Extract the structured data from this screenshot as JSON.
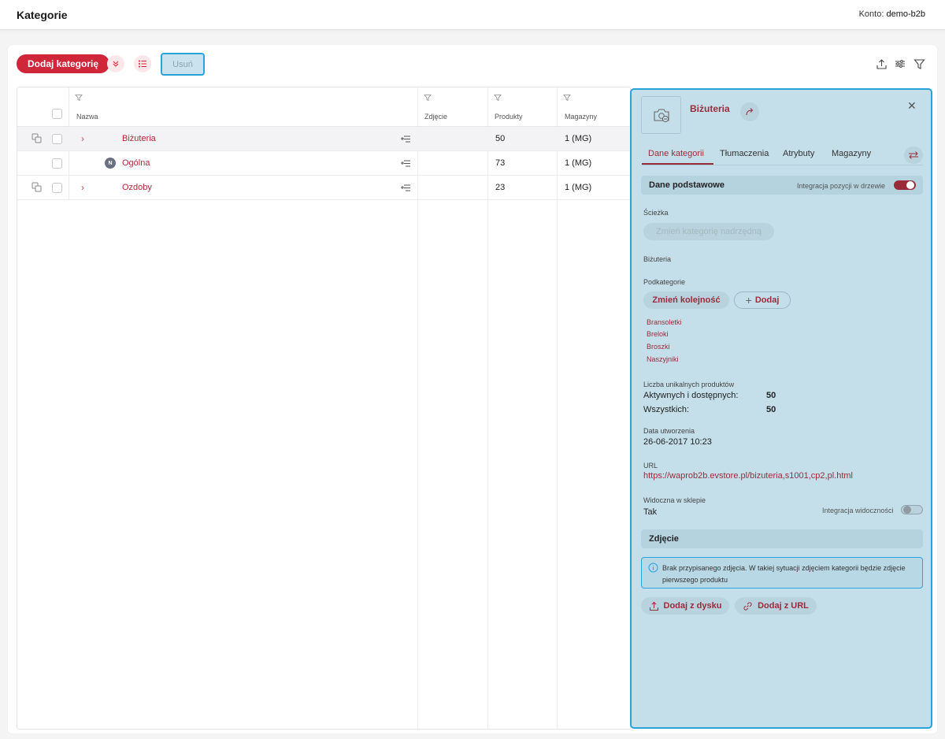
{
  "header": {
    "title": "Kategorie",
    "account_label": "Konto:",
    "account_value": "demo-b2b"
  },
  "toolbar": {
    "add_label": "Dodaj kategorię",
    "delete_label": "Usuń",
    "icons": [
      "chevrons-down-icon",
      "list-icon",
      "upload-icon",
      "sliders-icon",
      "filter-icon"
    ]
  },
  "grid": {
    "columns": [
      "Nazwa",
      "Zdjęcie",
      "Produkty",
      "Magazyny"
    ],
    "rows": [
      {
        "name": "Biżuteria",
        "products": "50",
        "warehouses": "1 (MG)",
        "expandable": true,
        "selected": true
      },
      {
        "name": "Ogólna",
        "products": "73",
        "warehouses": "1 (MG)",
        "expandable": false,
        "badge": "N"
      },
      {
        "name": "Ozdoby",
        "products": "23",
        "warehouses": "1 (MG)",
        "expandable": true
      }
    ]
  },
  "panel": {
    "title": "Biżuteria",
    "tabs": [
      "Dane kategorii",
      "Tłumaczenia",
      "Atrybuty",
      "Magazyny"
    ],
    "active_tab": "Dane kategorii",
    "basic_section": "Dane podstawowe",
    "tree_integration_label": "Integracja pozycji w drzewie",
    "path_label": "Ścieżka",
    "change_parent_label": "Zmień kategorię nadrzędną",
    "path_value": "Biżuteria",
    "subcategories_label": "Podkategorie",
    "reorder_label": "Zmień kolejność",
    "add_label": "Dodaj",
    "subcategories": [
      "Bransoletki",
      "Breloki",
      "Broszki",
      "Naszyjniki"
    ],
    "unique_products_label": "Liczba unikalnych produktów",
    "active_label": "Aktywnych i dostępnych:",
    "active_value": "50",
    "all_label": "Wszystkich:",
    "all_value": "50",
    "created_label": "Data utworzenia",
    "created_value": "26-06-2017 10:23",
    "url_label": "URL",
    "url_value": "https://waprob2b.evstore.pl/bizuteria,s1001,cp2,pl.html",
    "visible_label": "Widoczna w sklepie",
    "visible_value": "Tak",
    "visibility_integration_label": "Integracja widoczności",
    "photo_section": "Zdjęcie",
    "photo_info": "Brak przypisanego zdjęcia. W takiej sytuacji zdjęciem kategorii będzie zdjęcie pierwszego produktu",
    "add_from_disk": "Dodaj z dysku",
    "add_from_url": "Dodaj z URL"
  },
  "colors": {
    "accent": "#d0263a",
    "link": "#b22a3a",
    "panel_bg": "#c4dfea",
    "panel_border": "#29a3dc"
  }
}
